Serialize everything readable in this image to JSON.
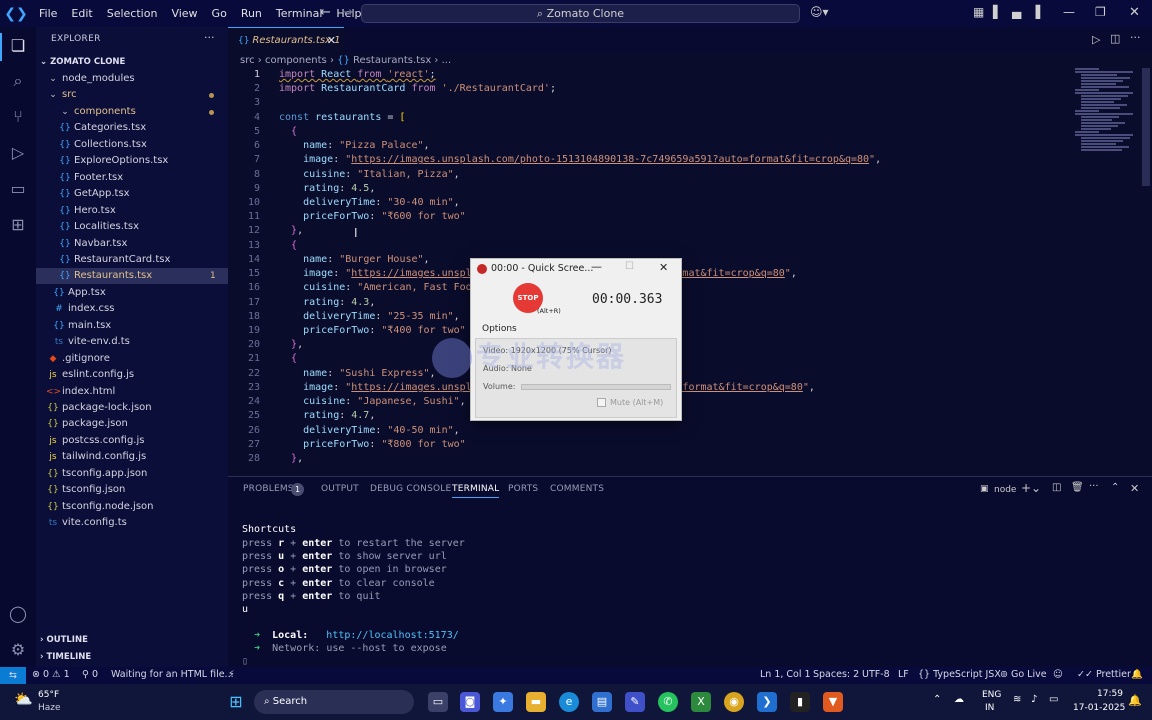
{
  "menu": [
    "File",
    "Edit",
    "Selection",
    "View",
    "Go",
    "Run",
    "Terminal",
    "Help"
  ],
  "search": {
    "label": "Zomato Clone"
  },
  "explorer": {
    "title": "EXPLORER",
    "project": "ZOMATO CLONE",
    "items": [
      {
        "name": "node_modules",
        "type": "folder",
        "depth": 1
      },
      {
        "name": "src",
        "type": "folder",
        "depth": 1
      },
      {
        "name": "components",
        "type": "folder",
        "depth": 2
      },
      {
        "name": "Categories.tsx",
        "type": "tsx",
        "depth": 3
      },
      {
        "name": "Collections.tsx",
        "type": "tsx",
        "depth": 3
      },
      {
        "name": "ExploreOptions.tsx",
        "type": "tsx",
        "depth": 3
      },
      {
        "name": "Footer.tsx",
        "type": "tsx",
        "depth": 3
      },
      {
        "name": "GetApp.tsx",
        "type": "tsx",
        "depth": 3
      },
      {
        "name": "Hero.tsx",
        "type": "tsx",
        "depth": 3
      },
      {
        "name": "Localities.tsx",
        "type": "tsx",
        "depth": 3
      },
      {
        "name": "Navbar.tsx",
        "type": "tsx",
        "depth": 3
      },
      {
        "name": "RestaurantCard.tsx",
        "type": "tsx",
        "depth": 3
      },
      {
        "name": "Restaurants.tsx",
        "type": "tsx",
        "depth": 3
      },
      {
        "name": "App.tsx",
        "type": "tsx",
        "depth": 2
      },
      {
        "name": "index.css",
        "type": "css",
        "depth": 2
      },
      {
        "name": "main.tsx",
        "type": "tsx",
        "depth": 2
      },
      {
        "name": "vite-env.d.ts",
        "type": "ts",
        "depth": 2
      },
      {
        "name": ".gitignore",
        "type": "git",
        "depth": 1
      },
      {
        "name": "eslint.config.js",
        "type": "js",
        "depth": 1
      },
      {
        "name": "index.html",
        "type": "html",
        "depth": 1
      },
      {
        "name": "package-lock.json",
        "type": "json",
        "depth": 1
      },
      {
        "name": "package.json",
        "type": "json",
        "depth": 1
      },
      {
        "name": "postcss.config.js",
        "type": "js",
        "depth": 1
      },
      {
        "name": "tailwind.config.js",
        "type": "js",
        "depth": 1
      },
      {
        "name": "tsconfig.app.json",
        "type": "json",
        "depth": 1
      },
      {
        "name": "tsconfig.json",
        "type": "json",
        "depth": 1
      },
      {
        "name": "tsconfig.node.json",
        "type": "json",
        "depth": 1
      },
      {
        "name": "vite.config.ts",
        "type": "ts",
        "depth": 1
      }
    ],
    "active_badge": "1",
    "outline": "OUTLINE",
    "timeline": "TIMELINE"
  },
  "tab": {
    "label": "Restaurants.tsx",
    "badge": "1"
  },
  "breadcrumb": [
    "src",
    "components",
    "Restaurants.tsx",
    "..."
  ],
  "code_lines": [
    [
      [
        "kw",
        "import "
      ],
      [
        "vr",
        "React "
      ],
      [
        "kw",
        "from "
      ],
      [
        "st",
        "'react'"
      ],
      [
        "pn",
        ";"
      ]
    ],
    [
      [
        "kw",
        "import "
      ],
      [
        "vr",
        "RestaurantCard "
      ],
      [
        "kw",
        "from "
      ],
      [
        "st",
        "'./RestaurantCard'"
      ],
      [
        "pn",
        ";"
      ]
    ],
    [],
    [
      [
        "kb",
        "const "
      ],
      [
        "vr",
        "restaurants "
      ],
      [
        "pn",
        "= "
      ],
      [
        "br1",
        "["
      ]
    ],
    [
      [
        "pn",
        "  "
      ],
      [
        "br2",
        "{"
      ]
    ],
    [
      [
        "pn",
        "    "
      ],
      [
        "vr",
        "name"
      ],
      [
        "pn",
        ": "
      ],
      [
        "st",
        "\"Pizza Palace\""
      ],
      [
        "pn",
        ","
      ]
    ],
    [
      [
        "pn",
        "    "
      ],
      [
        "vr",
        "image"
      ],
      [
        "pn",
        ": "
      ],
      [
        "st",
        "\""
      ],
      [
        "url",
        "https://images.unsplash.com/photo-1513104890138-7c749659a591?auto=format&fit=crop&q=80"
      ],
      [
        "st",
        "\""
      ],
      [
        "pn",
        ","
      ]
    ],
    [
      [
        "pn",
        "    "
      ],
      [
        "vr",
        "cuisine"
      ],
      [
        "pn",
        ": "
      ],
      [
        "st",
        "\"Italian, Pizza\""
      ],
      [
        "pn",
        ","
      ]
    ],
    [
      [
        "pn",
        "    "
      ],
      [
        "vr",
        "rating"
      ],
      [
        "pn",
        ": "
      ],
      [
        "nm",
        "4.5"
      ],
      [
        "pn",
        ","
      ]
    ],
    [
      [
        "pn",
        "    "
      ],
      [
        "vr",
        "deliveryTime"
      ],
      [
        "pn",
        ": "
      ],
      [
        "st",
        "\"30-40 min\""
      ],
      [
        "pn",
        ","
      ]
    ],
    [
      [
        "pn",
        "    "
      ],
      [
        "vr",
        "priceForTwo"
      ],
      [
        "pn",
        ": "
      ],
      [
        "st",
        "\"₹600 for two\""
      ]
    ],
    [
      [
        "pn",
        "  "
      ],
      [
        "br2",
        "}"
      ],
      [
        "pn",
        ","
      ]
    ],
    [
      [
        "pn",
        "  "
      ],
      [
        "br2",
        "{"
      ]
    ],
    [
      [
        "pn",
        "    "
      ],
      [
        "vr",
        "name"
      ],
      [
        "pn",
        ": "
      ],
      [
        "st",
        "\"Burger House\""
      ],
      [
        "pn",
        ","
      ]
    ],
    [
      [
        "pn",
        "    "
      ],
      [
        "vr",
        "image"
      ],
      [
        "pn",
        ": "
      ],
      [
        "st",
        "\""
      ],
      [
        "url",
        "https://images.unspla"
      ],
      [
        "pn",
        "                          "
      ],
      [
        "url",
        "auto=format&fit=crop&q=80"
      ],
      [
        "st",
        "\""
      ],
      [
        "pn",
        ","
      ]
    ],
    [
      [
        "pn",
        "    "
      ],
      [
        "vr",
        "cuisine"
      ],
      [
        "pn",
        ": "
      ],
      [
        "st",
        "\"American, Fast Food"
      ]
    ],
    [
      [
        "pn",
        "    "
      ],
      [
        "vr",
        "rating"
      ],
      [
        "pn",
        ": "
      ],
      [
        "nm",
        "4.3"
      ],
      [
        "pn",
        ","
      ]
    ],
    [
      [
        "pn",
        "    "
      ],
      [
        "vr",
        "deliveryTime"
      ],
      [
        "pn",
        ": "
      ],
      [
        "st",
        "\"25-35 min\""
      ],
      [
        "pn",
        ","
      ]
    ],
    [
      [
        "pn",
        "    "
      ],
      [
        "vr",
        "priceForTwo"
      ],
      [
        "pn",
        ": "
      ],
      [
        "st",
        "\"₹400 for two\""
      ]
    ],
    [
      [
        "pn",
        "  "
      ],
      [
        "br2",
        "}"
      ],
      [
        "pn",
        ","
      ]
    ],
    [
      [
        "pn",
        "  "
      ],
      [
        "br2",
        "{"
      ]
    ],
    [
      [
        "pn",
        "    "
      ],
      [
        "vr",
        "name"
      ],
      [
        "pn",
        ": "
      ],
      [
        "st",
        "\"Sushi Express\""
      ],
      [
        "pn",
        ","
      ]
    ],
    [
      [
        "pn",
        "    "
      ],
      [
        "vr",
        "image"
      ],
      [
        "pn",
        ": "
      ],
      [
        "st",
        "\""
      ],
      [
        "url",
        "https://images.unspla"
      ],
      [
        "pn",
        "                          "
      ],
      [
        "url",
        "6c?auto=format&fit=crop&q=80"
      ],
      [
        "st",
        "\""
      ],
      [
        "pn",
        ","
      ]
    ],
    [
      [
        "pn",
        "    "
      ],
      [
        "vr",
        "cuisine"
      ],
      [
        "pn",
        ": "
      ],
      [
        "st",
        "\"Japanese, Sushi\""
      ],
      [
        "pn",
        ","
      ]
    ],
    [
      [
        "pn",
        "    "
      ],
      [
        "vr",
        "rating"
      ],
      [
        "pn",
        ": "
      ],
      [
        "nm",
        "4.7"
      ],
      [
        "pn",
        ","
      ]
    ],
    [
      [
        "pn",
        "    "
      ],
      [
        "vr",
        "deliveryTime"
      ],
      [
        "pn",
        ": "
      ],
      [
        "st",
        "\"40-50 min\""
      ],
      [
        "pn",
        ","
      ]
    ],
    [
      [
        "pn",
        "    "
      ],
      [
        "vr",
        "priceForTwo"
      ],
      [
        "pn",
        ": "
      ],
      [
        "st",
        "\"₹800 for two\""
      ]
    ],
    [
      [
        "pn",
        "  "
      ],
      [
        "br2",
        "}"
      ],
      [
        "pn",
        ","
      ]
    ]
  ],
  "panel": {
    "tabs": [
      "PROBLEMS",
      "OUTPUT",
      "DEBUG CONSOLE",
      "TERMINAL",
      "PORTS",
      "COMMENTS"
    ],
    "problems_count": "1",
    "active_tab": "TERMINAL",
    "shell": "node"
  },
  "terminal": {
    "shortcuts_title": "Shortcuts",
    "shortcuts": [
      {
        "key": "r + enter",
        "desc": "to restart the server"
      },
      {
        "key": "u + enter",
        "desc": "to show server url"
      },
      {
        "key": "o + enter",
        "desc": "to open in browser"
      },
      {
        "key": "c + enter",
        "desc": "to clear console"
      },
      {
        "key": "q + enter",
        "desc": "to quit"
      }
    ],
    "press": "press",
    "input": "u",
    "local_label": "Local:",
    "local_url": "http://localhost:5173/",
    "network_label": "Network:",
    "network_text": "use --host to expose"
  },
  "statusbar": {
    "errors": "0",
    "warnings": "1",
    "info": "0",
    "message": "Waiting for an HTML file...",
    "position": "Ln 1, Col 1",
    "spaces": "Spaces: 2",
    "encoding": "UTF-8",
    "eol": "LF",
    "language": "TypeScript JSX",
    "golive": "Go Live",
    "prettier": "Prettier"
  },
  "recorder": {
    "title": "00:00 - Quick Scree...",
    "stop": "STOP",
    "shortcut": "(Alt+R)",
    "time": "00:00.363",
    "options": "Options",
    "video": "Video: 1920x1200 (75% Cursor)",
    "audio": "Audio: None",
    "volume": "Volume:",
    "mute": "Mute (Alt+M)"
  },
  "watermark": "专业转换器",
  "taskbar": {
    "weather_temp": "65°F",
    "weather_desc": "Haze",
    "search": "Search",
    "lang1": "ENG",
    "lang2": "IN",
    "time": "17:59",
    "date": "17-01-2025"
  },
  "colors": {
    "accent": "#3ea6ff",
    "statusbar": "#070a3a",
    "stop_red": "#e53935"
  }
}
